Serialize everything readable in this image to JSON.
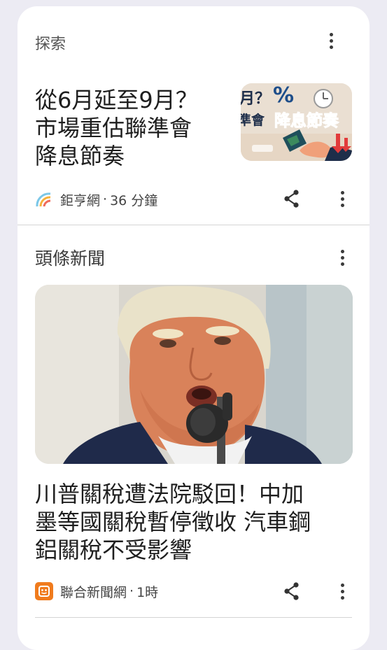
{
  "explore": {
    "title": "探索",
    "article": {
      "headline": [
        "從6月延至9月？",
        "市場重估聯準會",
        "降息節奏"
      ],
      "source": "鉅亨網",
      "time": "36 分鐘",
      "thumb_text": {
        "line1": "月？",
        "percent": "%",
        "bottom_left": "準會",
        "bottom_right": "降息節奏"
      }
    }
  },
  "top_news": {
    "title": "頭條新聞",
    "article": {
      "headline": [
        "川普關稅遭法院駁回！中加",
        "墨等國關稅暫停徵收 汽車鋼",
        "鋁關稅不受影響"
      ],
      "source": "聯合新聞網",
      "time": "1時"
    }
  },
  "meta_separator": "·",
  "icons": {
    "menu": "more-vert-icon",
    "share": "share-icon",
    "source_logo_1": "cnyes-logo-icon",
    "source_logo_2": "udn-logo-icon"
  },
  "colors": {
    "page_bg": "#ECEBF3",
    "card_bg": "#FFFFFF",
    "udn_orange": "#F07B1D"
  }
}
